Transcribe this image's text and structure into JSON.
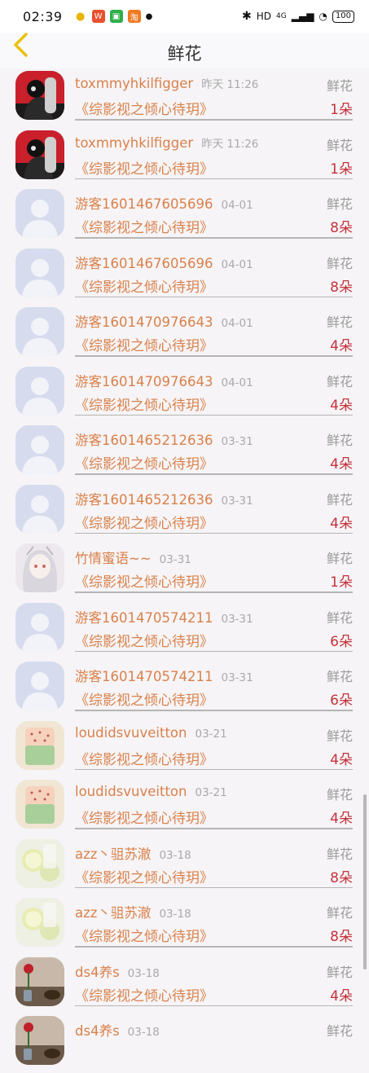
{
  "status_bar": {
    "time": "02:39",
    "right_text": "HD",
    "signal": "4G",
    "battery": "100"
  },
  "header": {
    "title": "鲜花"
  },
  "items": [
    {
      "name": "toxmmyhkilfigger",
      "date": "昨天 11:26",
      "type": "鲜花",
      "book": "《综影视之倾心待玥》",
      "count": "1朵",
      "avatar": "photo-dark"
    },
    {
      "name": "toxmmyhkilfigger",
      "date": "昨天 11:26",
      "type": "鲜花",
      "book": "《综影视之倾心待玥》",
      "count": "1朵",
      "avatar": "photo-dark"
    },
    {
      "name": "游客1601467605696",
      "date": "04-01",
      "type": "鲜花",
      "book": "《综影视之倾心待玥》",
      "count": "8朵",
      "avatar": "default"
    },
    {
      "name": "游客1601467605696",
      "date": "04-01",
      "type": "鲜花",
      "book": "《综影视之倾心待玥》",
      "count": "8朵",
      "avatar": "default"
    },
    {
      "name": "游客1601470976643",
      "date": "04-01",
      "type": "鲜花",
      "book": "《综影视之倾心待玥》",
      "count": "4朵",
      "avatar": "default"
    },
    {
      "name": "游客1601470976643",
      "date": "04-01",
      "type": "鲜花",
      "book": "《综影视之倾心待玥》",
      "count": "4朵",
      "avatar": "default"
    },
    {
      "name": "游客1601465212636",
      "date": "03-31",
      "type": "鲜花",
      "book": "《综影视之倾心待玥》",
      "count": "4朵",
      "avatar": "default"
    },
    {
      "name": "游客1601465212636",
      "date": "03-31",
      "type": "鲜花",
      "book": "《综影视之倾心待玥》",
      "count": "4朵",
      "avatar": "default"
    },
    {
      "name": "竹情蜜语~~",
      "date": "03-31",
      "type": "鲜花",
      "book": "《综影视之倾心待玥》",
      "count": "1朵",
      "avatar": "anime"
    },
    {
      "name": "游客1601470574211",
      "date": "03-31",
      "type": "鲜花",
      "book": "《综影视之倾心待玥》",
      "count": "6朵",
      "avatar": "default"
    },
    {
      "name": "游客1601470574211",
      "date": "03-31",
      "type": "鲜花",
      "book": "《综影视之倾心待玥》",
      "count": "6朵",
      "avatar": "default"
    },
    {
      "name": "loudidsvuveitton",
      "date": "03-21",
      "type": "鲜花",
      "book": "《综影视之倾心待玥》",
      "count": "4朵",
      "avatar": "cake"
    },
    {
      "name": "loudidsvuveitton",
      "date": "03-21",
      "type": "鲜花",
      "book": "《综影视之倾心待玥》",
      "count": "4朵",
      "avatar": "cake"
    },
    {
      "name": "azz丶驵苏澈",
      "date": "03-18",
      "type": "鲜花",
      "book": "《综影视之倾心待玥》",
      "count": "8朵",
      "avatar": "lemon"
    },
    {
      "name": "azz丶驵苏澈",
      "date": "03-18",
      "type": "鲜花",
      "book": "《综影视之倾心待玥》",
      "count": "8朵",
      "avatar": "lemon"
    },
    {
      "name": "ds4养s",
      "date": "03-18",
      "type": "鲜花",
      "book": "《综影视之倾心待玥》",
      "count": "4朵",
      "avatar": "rose"
    },
    {
      "name": "ds4养s",
      "date": "03-18",
      "type": "鲜花",
      "book": "",
      "count": "",
      "avatar": "rose"
    }
  ]
}
